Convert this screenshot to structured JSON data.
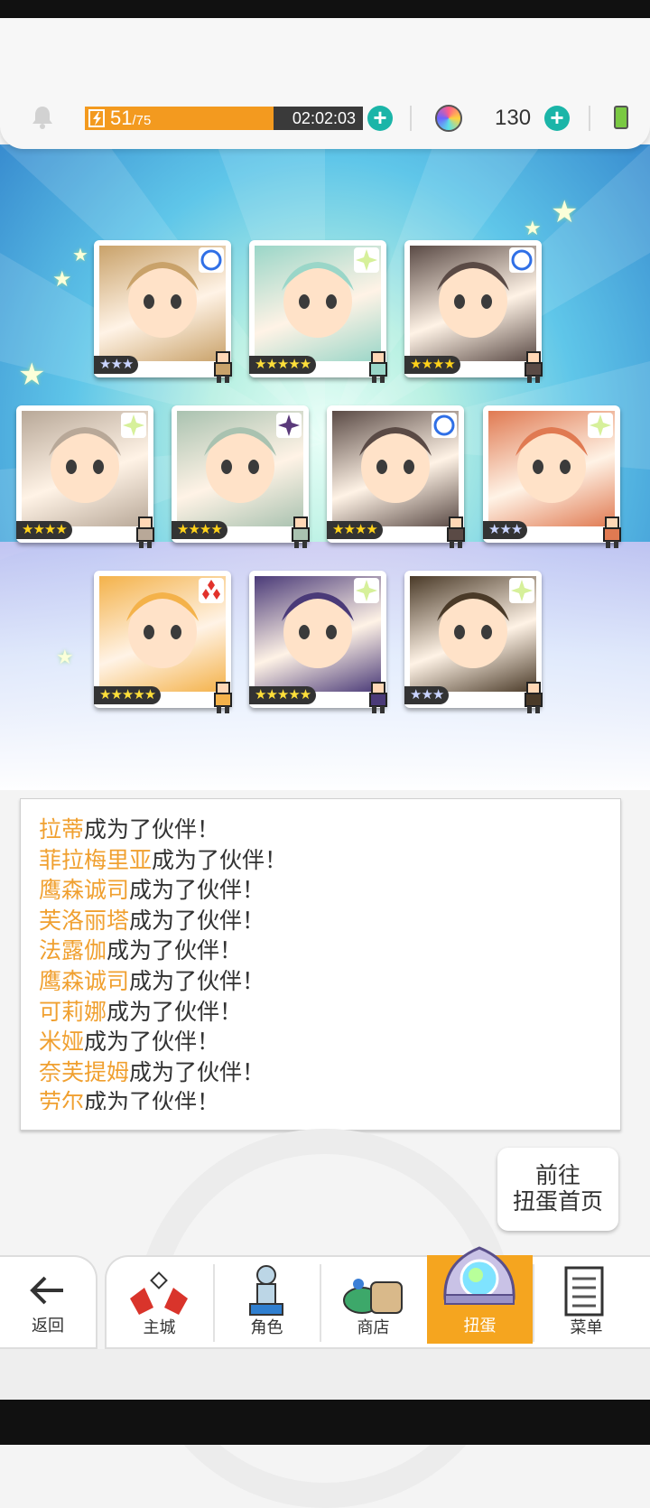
{
  "header": {
    "energy_current": "51",
    "energy_max": "/75",
    "energy_fraction": 0.68,
    "timer": "02:02:03",
    "gems": "130",
    "icons": [
      "bell-icon",
      "energy-icon",
      "plus-icon",
      "rainbow-gem-icon",
      "battery-icon"
    ],
    "colors": {
      "energy": "#f39a1f",
      "plus": "#1bb5a8",
      "active_tab": "#f5a51f",
      "name_text": "#f0a030"
    }
  },
  "results": {
    "rows": [
      [
        {
          "stars": "★★★",
          "rarity": "blue-circle",
          "bg": "#c9a26a"
        },
        {
          "stars": "★★★★★",
          "rarity": "sparkle",
          "bg": "#9ad6c8"
        },
        {
          "stars": "★★★★",
          "rarity": "blue-circle",
          "bg": "#5a4a45"
        }
      ],
      [
        {
          "stars": "★★★★",
          "rarity": "sparkle",
          "bg": "#b8a898"
        },
        {
          "stars": "★★★★",
          "rarity": "purple-sparkle",
          "bg": "#a9c2b0"
        },
        {
          "stars": "★★★★",
          "rarity": "blue-circle",
          "bg": "#5a4a45"
        },
        {
          "stars": "★★★",
          "rarity": "sparkle",
          "bg": "#e07a52"
        }
      ],
      [
        {
          "stars": "★★★★★",
          "rarity": "red-diamonds",
          "bg": "#f4b24a"
        },
        {
          "stars": "★★★★★",
          "rarity": "sparkle",
          "bg": "#4a3a78"
        },
        {
          "stars": "★★★",
          "rarity": "sparkle",
          "bg": "#4a3a28"
        }
      ]
    ]
  },
  "log": {
    "suffix": "成为了伙伴！",
    "names": [
      "拉蒂",
      "菲拉梅里亚",
      "鹰森诚司",
      "芙洛丽塔",
      "法露伽",
      "鹰森诚司",
      "可莉娜",
      "米娅",
      "奈芙提姆",
      "劳尔"
    ]
  },
  "goto_button": {
    "line1": "前往",
    "line2": "扭蛋首页"
  },
  "nav": {
    "back": "返回",
    "tabs": [
      "主城",
      "角色",
      "商店",
      "扭蛋",
      "菜单"
    ],
    "active_tab": "扭蛋"
  }
}
